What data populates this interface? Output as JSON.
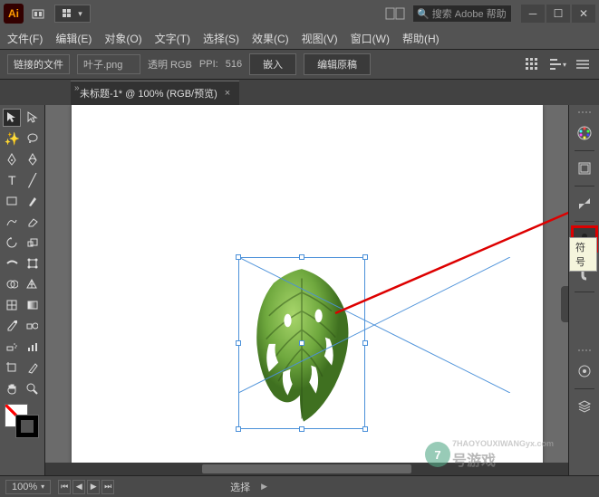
{
  "title": {
    "search_placeholder": "搜索 Adobe 帮助"
  },
  "menu": {
    "file": "文件(F)",
    "edit": "编辑(E)",
    "object": "对象(O)",
    "type": "文字(T)",
    "select": "选择(S)",
    "effect": "效果(C)",
    "view": "视图(V)",
    "window": "窗口(W)",
    "help": "帮助(H)"
  },
  "propbar": {
    "linked_label": "链接的文件",
    "filename": "叶子.png",
    "colormode": "透明 RGB",
    "ppi_label": "PPI:",
    "ppi": "516",
    "embed": "嵌入",
    "edit_original": "编辑原稿"
  },
  "tab": {
    "title": "未标题-1* @ 100% (RGB/预览)"
  },
  "tooltip": {
    "symbol": "符号"
  },
  "status": {
    "zoom": "100%",
    "mode": "选择"
  },
  "watermark": {
    "text": "号游戏",
    "url": "7HAOYOUXIWANGyx.com",
    "badge": "7"
  }
}
